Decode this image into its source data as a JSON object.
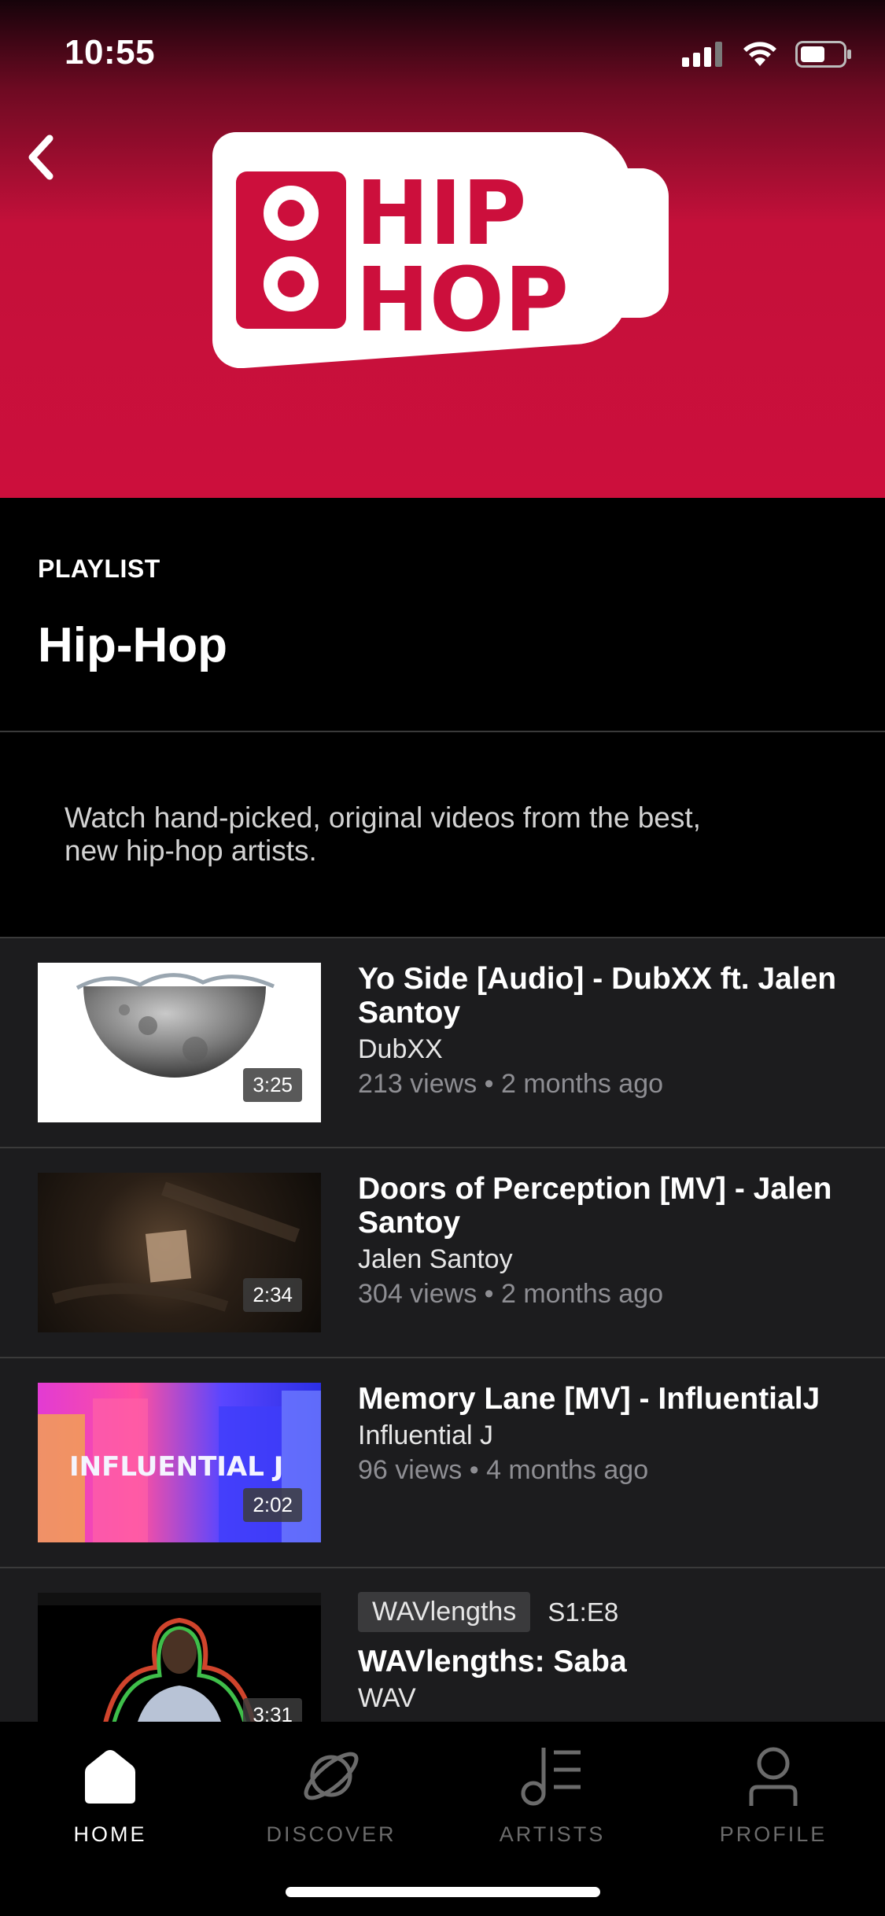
{
  "status_bar": {
    "time": "10:55"
  },
  "hero": {
    "logo_text_line1": "HIP",
    "logo_text_line2": "HOP"
  },
  "header": {
    "eyebrow": "PLAYLIST",
    "title": "Hip-Hop"
  },
  "description": "Watch hand-picked, original videos from the best, new hip-hop artists.",
  "videos": [
    {
      "title": "Yo Side [Audio]  - DubXX ft. Jalen Santoy",
      "channel": "DubXX",
      "meta": "213 views • 2 months ago",
      "duration": "3:25"
    },
    {
      "title": "Doors of Perception [MV] - Jalen Santoy",
      "channel": "Jalen Santoy",
      "meta": "304 views • 2 months ago",
      "duration": "2:34"
    },
    {
      "title": "Memory Lane [MV] - InfluentialJ",
      "channel": "Influential J",
      "meta": "96 views • 4 months ago",
      "duration": "2:02",
      "thumb_text": "INFLUENTIAL J"
    },
    {
      "series": "WAVlengths",
      "episode": "S1:E8",
      "title": "WAVlengths: Saba",
      "channel": "WAV",
      "duration": "3:31"
    }
  ],
  "tabs": [
    {
      "label": "HOME",
      "icon": "home-icon",
      "active": true
    },
    {
      "label": "DISCOVER",
      "icon": "planet-icon",
      "active": false
    },
    {
      "label": "ARTISTS",
      "icon": "music-note-list-icon",
      "active": false
    },
    {
      "label": "PROFILE",
      "icon": "person-icon",
      "active": false
    }
  ],
  "colors": {
    "accent": "#cc0f3c",
    "background": "#000000",
    "list_background": "#1c1c1e"
  }
}
